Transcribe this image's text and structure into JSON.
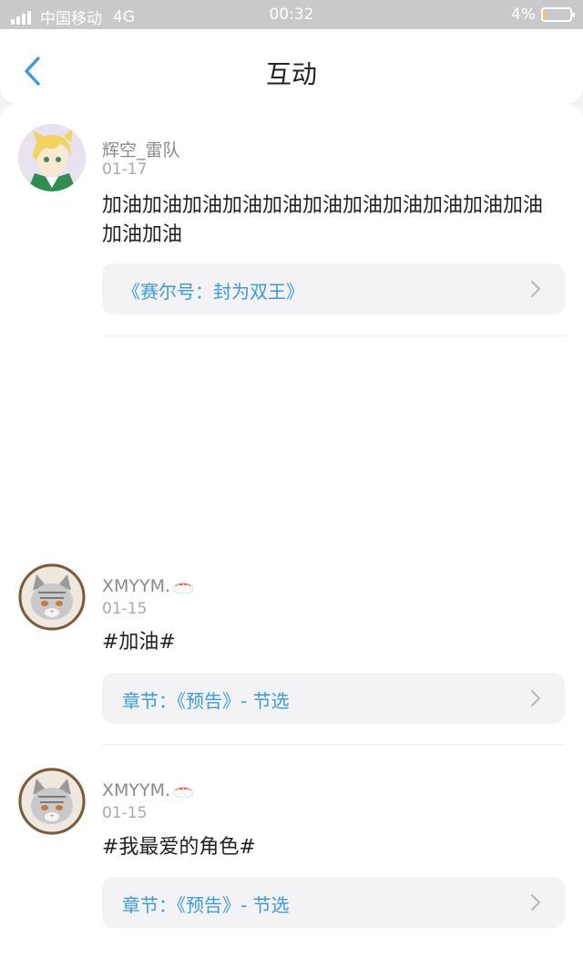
{
  "status_bar": {
    "carrier": "中国移动",
    "network": "4G",
    "time": "00:32",
    "battery": "4%",
    "battery_level": 0.04,
    "battery_color": "#f5c842"
  },
  "nav": {
    "back_icon": "chevron-left-icon",
    "title": "互动",
    "accent": "#3a9be0"
  },
  "posts": [
    {
      "username": "辉空_雷队",
      "date": "01-17",
      "text": "加油加油加油加油加油加油加油加油加油加油加油加油加油",
      "link_label": "《赛尔号：封为双王》",
      "chevron_icon": "chevron-right-icon"
    },
    {
      "username": "XMYYM.",
      "badge_icon": "sushi-emoji-icon",
      "date": "01-15",
      "text": "#加油#",
      "link_label": "章节：《预告》- 节选",
      "chevron_icon": "chevron-right-icon"
    },
    {
      "username": "XMYYM.",
      "badge_icon": "sushi-emoji-icon",
      "date": "01-15",
      "text": "#我最爱的角色#",
      "link_label": "章节：《预告》- 节选",
      "chevron_icon": "chevron-right-icon"
    }
  ]
}
